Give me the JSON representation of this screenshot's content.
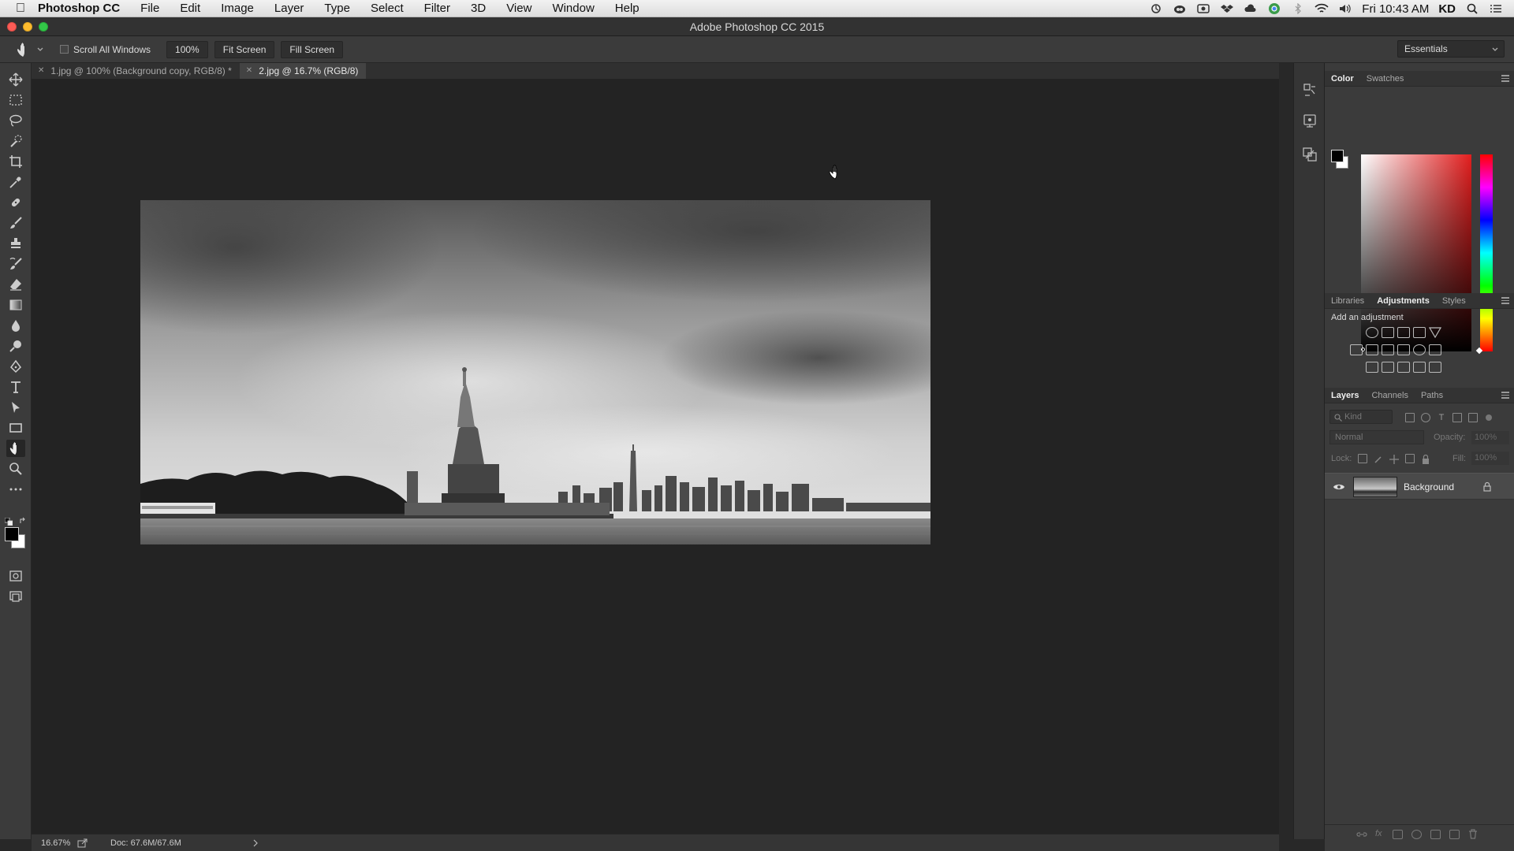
{
  "menubar": {
    "app_name": "Photoshop CC",
    "items": [
      "File",
      "Edit",
      "Image",
      "Layer",
      "Type",
      "Select",
      "Filter",
      "3D",
      "View",
      "Window",
      "Help"
    ],
    "clock": "Fri 10:43 AM",
    "user": "KD"
  },
  "window": {
    "title": "Adobe Photoshop CC 2015"
  },
  "options_bar": {
    "scroll_all_label": "Scroll All Windows",
    "zoom_button": "100%",
    "fit_screen_button": "Fit Screen",
    "fill_screen_button": "Fill Screen",
    "workspace": "Essentials"
  },
  "tabs": [
    {
      "label": "1.jpg @ 100% (Background copy, RGB/8) *"
    },
    {
      "label": "2.jpg @ 16.7% (RGB/8)"
    }
  ],
  "status_bar": {
    "zoom": "16.67%",
    "doc": "Doc: 67.6M/67.6M"
  },
  "color_panel": {
    "tabs": [
      "Color",
      "Swatches"
    ],
    "hue_color": "#e21e1e"
  },
  "adjustments_panel": {
    "tabs": [
      "Libraries",
      "Adjustments",
      "Styles"
    ],
    "heading": "Add an adjustment"
  },
  "layers_panel": {
    "tabs": [
      "Layers",
      "Channels",
      "Paths"
    ],
    "filter_placeholder": "Kind",
    "blend_mode": "Normal",
    "opacity_label": "Opacity:",
    "opacity_value": "100%",
    "lock_label": "Lock:",
    "fill_label": "Fill:",
    "fill_value": "100%",
    "layers": [
      {
        "name": "Background",
        "locked": true,
        "visible": true
      }
    ]
  },
  "toolbar": {
    "tools": [
      "move-tool-icon",
      "marquee-tool-icon",
      "lasso-tool-icon",
      "quick-selection-tool-icon",
      "crop-tool-icon",
      "eyedropper-tool-icon",
      "healing-brush-tool-icon",
      "brush-tool-icon",
      "clone-stamp-tool-icon",
      "history-brush-tool-icon",
      "eraser-tool-icon",
      "gradient-tool-icon",
      "blur-tool-icon",
      "dodge-tool-icon",
      "pen-tool-icon",
      "type-tool-icon",
      "path-selection-tool-icon",
      "rectangle-tool-icon",
      "hand-tool-icon",
      "zoom-tool-icon",
      "edit-toolbar-icon"
    ],
    "active": "hand-tool-icon"
  }
}
